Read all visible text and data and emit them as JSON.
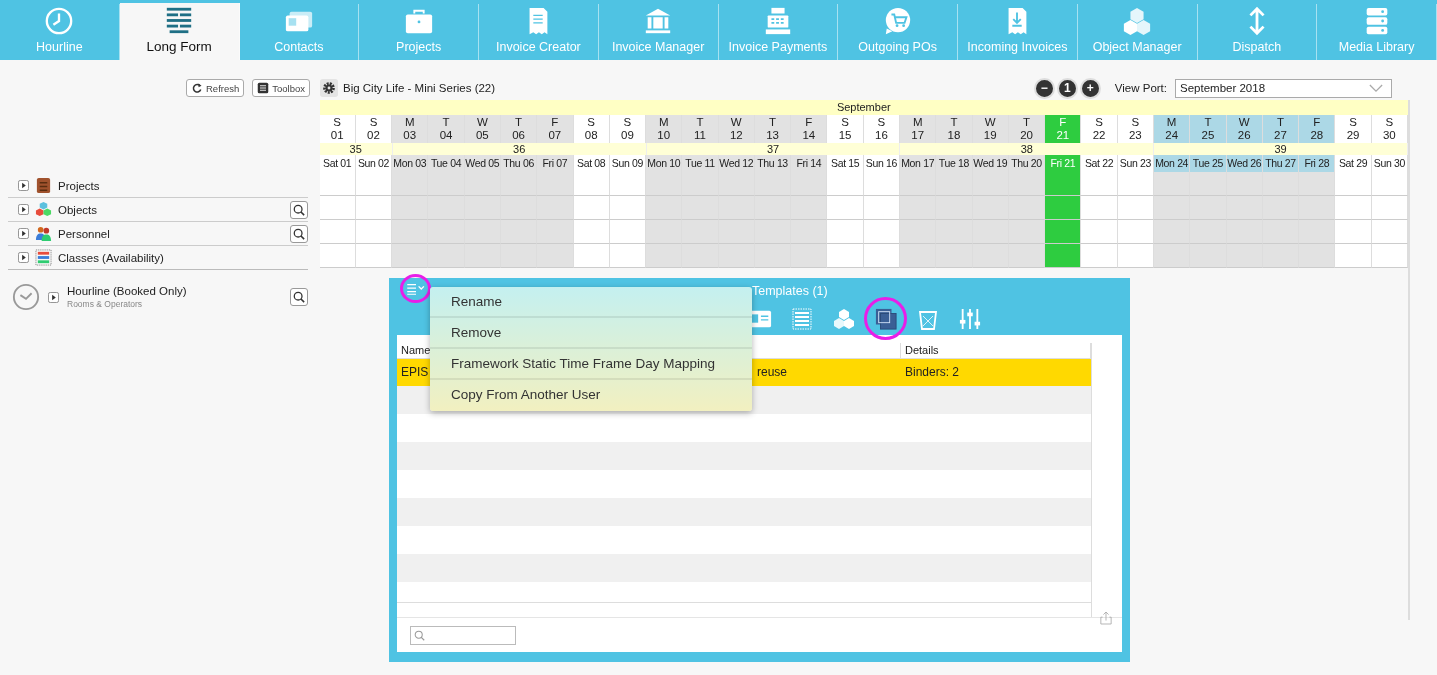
{
  "nav": [
    {
      "label": "Hourline",
      "selected": false
    },
    {
      "label": "Long Form",
      "selected": true
    },
    {
      "label": "Contacts",
      "selected": false
    },
    {
      "label": "Projects",
      "selected": false
    },
    {
      "label": "Invoice Creator",
      "selected": false
    },
    {
      "label": "Invoice Manager",
      "selected": false
    },
    {
      "label": "Invoice Payments",
      "selected": false
    },
    {
      "label": "Outgoing POs",
      "selected": false
    },
    {
      "label": "Incoming Invoices",
      "selected": false
    },
    {
      "label": "Object Manager",
      "selected": false
    },
    {
      "label": "Dispatch",
      "selected": false
    },
    {
      "label": "Media Library",
      "selected": false
    }
  ],
  "toolbar": {
    "buttons": [
      "Refresh",
      "Toolbox"
    ],
    "project_title": "Big City Life - Mini Series (22)",
    "zoom_buttons": [
      "−",
      "1",
      "+"
    ],
    "viewport_label": "View Port:",
    "viewport_value": "September 2018"
  },
  "tree": [
    {
      "label": "Projects",
      "search": false
    },
    {
      "label": "Objects",
      "search": true
    },
    {
      "label": "Personnel",
      "search": true
    },
    {
      "label": "Classes (Availability)",
      "search": false
    }
  ],
  "hourline": {
    "title": "Hourline (Booked Only)",
    "subtitle": "Rooms & Operators"
  },
  "calendar": {
    "month": "September",
    "weeks": [
      {
        "label": "35",
        "days": [
          {
            "letter": "S",
            "date": "01",
            "label": "Sat 01",
            "kind": "weekend"
          },
          {
            "letter": "S",
            "date": "02",
            "label": "Sun 02",
            "kind": "weekend"
          }
        ]
      },
      {
        "label": "36",
        "days": [
          {
            "letter": "M",
            "date": "03",
            "label": "Mon 03",
            "kind": "weekday"
          },
          {
            "letter": "T",
            "date": "04",
            "label": "Tue 04",
            "kind": "weekday"
          },
          {
            "letter": "W",
            "date": "05",
            "label": "Wed 05",
            "kind": "weekday"
          },
          {
            "letter": "T",
            "date": "06",
            "label": "Thu 06",
            "kind": "weekday"
          },
          {
            "letter": "F",
            "date": "07",
            "label": "Fri 07",
            "kind": "weekday"
          },
          {
            "letter": "S",
            "date": "08",
            "label": "Sat 08",
            "kind": "weekend"
          },
          {
            "letter": "S",
            "date": "09",
            "label": "Sun 09",
            "kind": "weekend"
          }
        ]
      },
      {
        "label": "37",
        "days": [
          {
            "letter": "M",
            "date": "10",
            "label": "Mon 10",
            "kind": "weekday"
          },
          {
            "letter": "T",
            "date": "11",
            "label": "Tue 11",
            "kind": "weekday"
          },
          {
            "letter": "W",
            "date": "12",
            "label": "Wed 12",
            "kind": "weekday"
          },
          {
            "letter": "T",
            "date": "13",
            "label": "Thu 13",
            "kind": "weekday"
          },
          {
            "letter": "F",
            "date": "14",
            "label": "Fri 14",
            "kind": "weekday"
          },
          {
            "letter": "S",
            "date": "15",
            "label": "Sat 15",
            "kind": "weekend"
          },
          {
            "letter": "S",
            "date": "16",
            "label": "Sun 16",
            "kind": "weekend"
          }
        ]
      },
      {
        "label": "38",
        "days": [
          {
            "letter": "M",
            "date": "17",
            "label": "Mon 17",
            "kind": "weekday"
          },
          {
            "letter": "T",
            "date": "18",
            "label": "Tue 18",
            "kind": "weekday"
          },
          {
            "letter": "W",
            "date": "19",
            "label": "Wed 19",
            "kind": "weekday"
          },
          {
            "letter": "T",
            "date": "20",
            "label": "Thu 20",
            "kind": "weekday"
          },
          {
            "letter": "F",
            "date": "21",
            "label": "Fri 21",
            "kind": "today"
          },
          {
            "letter": "S",
            "date": "22",
            "label": "Sat 22",
            "kind": "weekend"
          },
          {
            "letter": "S",
            "date": "23",
            "label": "Sun 23",
            "kind": "weekend"
          }
        ]
      },
      {
        "label": "39",
        "days": [
          {
            "letter": "M",
            "date": "24",
            "label": "Mon 24",
            "kind": "highlight"
          },
          {
            "letter": "T",
            "date": "25",
            "label": "Tue 25",
            "kind": "highlight"
          },
          {
            "letter": "W",
            "date": "26",
            "label": "Wed 26",
            "kind": "highlight"
          },
          {
            "letter": "T",
            "date": "27",
            "label": "Thu 27",
            "kind": "highlight"
          },
          {
            "letter": "F",
            "date": "28",
            "label": "Fri 28",
            "kind": "highlight"
          },
          {
            "letter": "S",
            "date": "29",
            "label": "Sat 29",
            "kind": "weekend"
          },
          {
            "letter": "S",
            "date": "30",
            "label": "Sun 30",
            "kind": "weekend"
          }
        ]
      }
    ]
  },
  "panel": {
    "title": "Templates (1)",
    "table": {
      "columns": [
        {
          "label": "Name"
        },
        {},
        {
          "label": "Details"
        }
      ],
      "rows": [
        {
          "cells": [
            "EPIS",
            "reuse",
            "Binders: 2"
          ],
          "selected": true
        }
      ]
    }
  },
  "menu": {
    "items": [
      "Rename",
      "Remove",
      "Framework Static Time Frame Day Mapping",
      "Copy From Another User"
    ]
  }
}
